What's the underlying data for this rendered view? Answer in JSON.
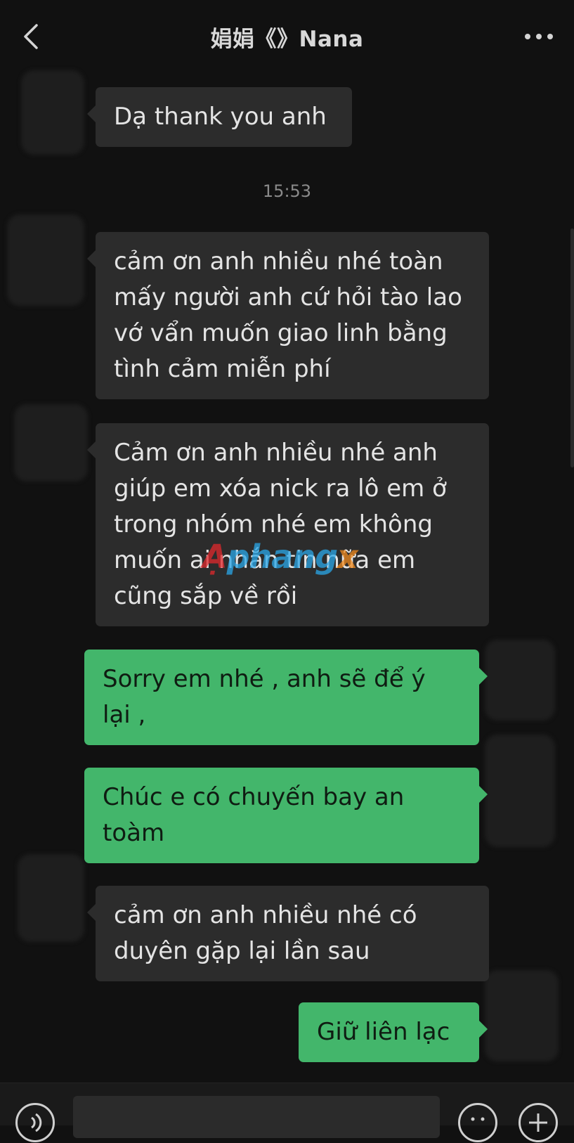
{
  "header": {
    "title": "娟娟《》Nana",
    "back_icon": "chevron-left-icon",
    "more_icon": "more-horizontal-icon"
  },
  "messages": [
    {
      "side": "in",
      "text": "Dạ thank you anh"
    },
    {
      "side": "in",
      "text": "cảm ơn anh nhiều nhé toàn mấy người anh cứ hỏi tào lao vớ vẩn muốn giao linh bằng tình cảm miễn phí"
    },
    {
      "side": "in",
      "text": "Cảm ơn anh nhiều nhé anh giúp em xóa nick ra lô em ở trong nhóm nhé em không muốn ai nhắn tin nữa em cũng sắp về rồi"
    },
    {
      "side": "out",
      "text": "Sorry em nhé , anh sẽ để ý lại ,"
    },
    {
      "side": "out",
      "text": "Chúc e có chuyến bay an toàm"
    },
    {
      "side": "in",
      "text": "cảm ơn anh nhiều nhé có duyên gặp lại lần sau"
    },
    {
      "side": "out",
      "text": "Giữ liên lạc"
    }
  ],
  "timestamp": "15:53",
  "watermark": {
    "part1": "Ạ",
    "part2": "phang",
    "part3": "x"
  },
  "colors": {
    "background": "#111111",
    "incoming_bubble": "#2c2c2c",
    "outgoing_bubble": "#43b66b",
    "timestamp": "#8a8a8a"
  },
  "bottom_bar": {
    "voice_icon": "voice-icon",
    "emoji_icon": "emoji-icon",
    "plus_icon": "plus-icon"
  }
}
